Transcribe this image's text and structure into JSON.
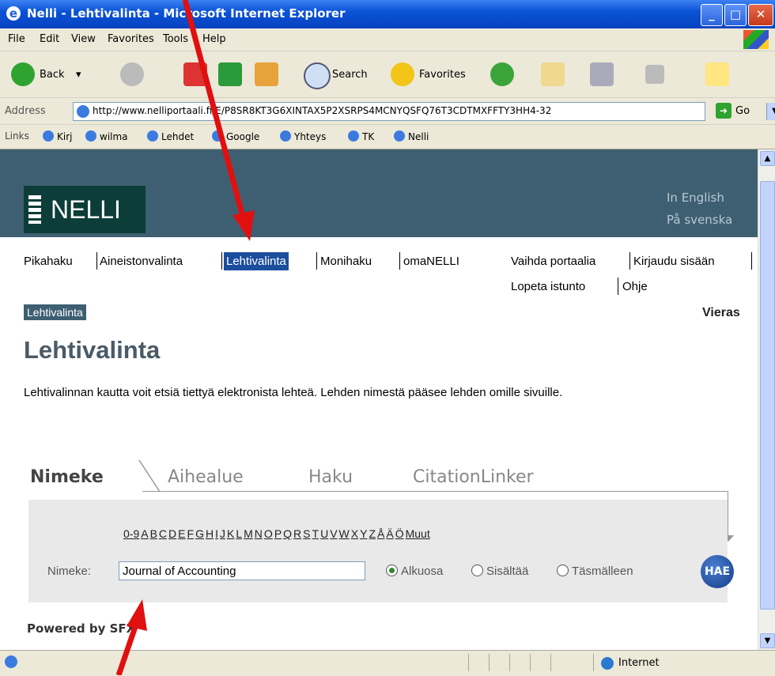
{
  "window": {
    "title": "Nelli - Lehtivalinta - Microsoft Internet Explorer",
    "icons": [
      "ie-icon",
      "minimize-icon",
      "maximize-icon",
      "close-icon"
    ]
  },
  "menu": [
    "File",
    "Edit",
    "View",
    "Favorites",
    "Tools",
    "Help"
  ],
  "toolbar": {
    "back_label": "Back",
    "search_label": "Search",
    "favorites_label": "Favorites"
  },
  "address": {
    "label": "Address",
    "url": "http://www.nelliportaali.fi/E/P8SR8KT3G6XINTAX5P2XSRPS4MCNYQSFQ76T3CDTMXFFTY3HH4-32",
    "go_label": "Go"
  },
  "links": {
    "label": "Links",
    "items": [
      "Kirj",
      "wilma",
      "Lehdet",
      "Google",
      "Yhteys",
      "TK",
      "Nelli"
    ]
  },
  "header": {
    "logo_text": "NELLI",
    "lang_en": "In English",
    "lang_sv": "På svenska"
  },
  "nav": {
    "items": [
      "Pikahaku",
      "Aineistonvalinta",
      "Lehtivalinta",
      "Monihaku",
      "omaNELLI"
    ],
    "right_items": [
      "Vaihda portaalia",
      "Kirjaudu sisään",
      "Lopeta istunto",
      "Ohje"
    ]
  },
  "breadcrumb": "Lehtivalinta",
  "user": "Vieras",
  "page_title": "Lehtivalinta",
  "intro": "Lehtivalinnan kautta voit etsiä tiettyä elektronista lehteä. Lehden nimestä pääsee lehden omille sivuille.",
  "tabs": [
    "Nimeke",
    "Aihealue",
    "Haku",
    "CitationLinker"
  ],
  "alphabet": [
    "0-9",
    "A",
    "B",
    "C",
    "D",
    "E",
    "F",
    "G",
    "H",
    "I",
    "J",
    "K",
    "L",
    "M",
    "N",
    "O",
    "P",
    "Q",
    "R",
    "S",
    "T",
    "U",
    "V",
    "W",
    "X",
    "Y",
    "Z",
    "Å",
    "Ä",
    "Ö",
    "Muut"
  ],
  "search": {
    "label": "Nimeke:",
    "value": "Journal of Accounting",
    "options": [
      "Alkuosa",
      "Sisältää",
      "Täsmälleen"
    ],
    "selected": "Alkuosa",
    "button": "HAE"
  },
  "powered_by": "Powered by SFX",
  "status": {
    "zone": "Internet"
  },
  "colors": {
    "header_bg": "#3e5f72",
    "active_nav": "#1c4e9e",
    "arrow": "#e01010"
  }
}
